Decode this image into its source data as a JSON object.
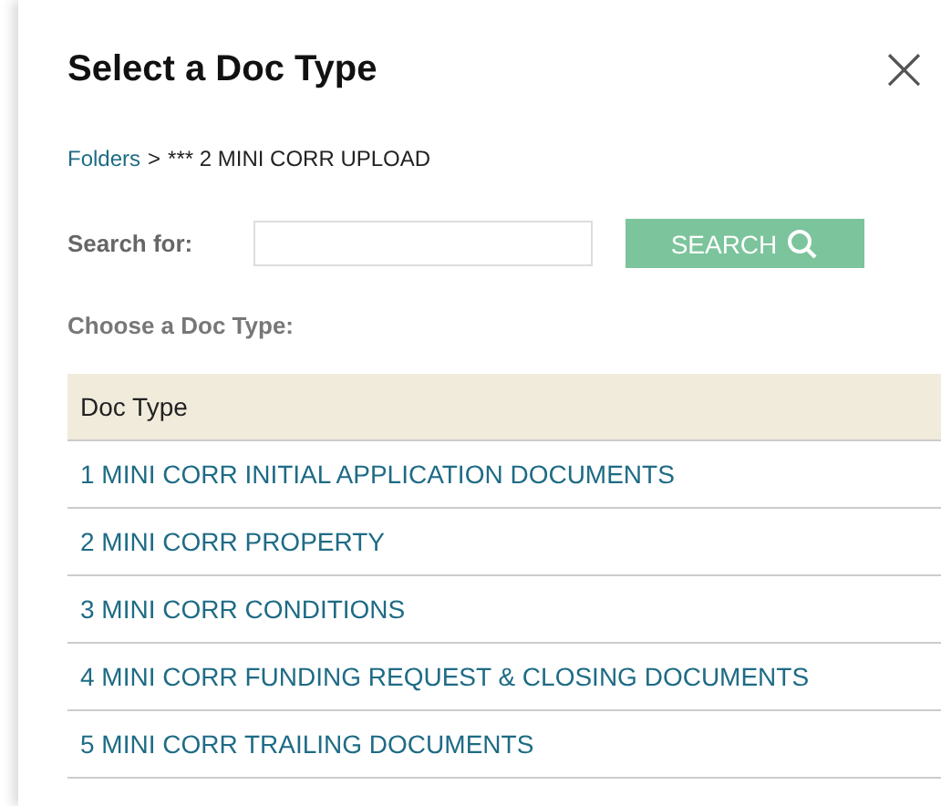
{
  "dialog": {
    "title": "Select a Doc Type",
    "close": "×"
  },
  "breadcrumb": {
    "link": "Folders",
    "separator": ">",
    "current": "*** 2 MINI CORR UPLOAD"
  },
  "search": {
    "label": "Search for:",
    "button": "SEARCH",
    "disabled": true
  },
  "prompt": "Choose a Doc Type:",
  "table": {
    "columns": [
      "Doc Type"
    ],
    "rows": [
      {
        "name": "1 MINI CORR INITIAL APPLICATION DOCUMENTS"
      },
      {
        "name": "2 MINI CORR PROPERTY"
      },
      {
        "name": "3 MINI CORR CONDITIONS"
      },
      {
        "name": "4 MINI CORR FUNDING REQUEST & CLOSING DOCUMENTS"
      },
      {
        "name": "5 MINI CORR TRAILING DOCUMENTS"
      }
    ]
  }
}
